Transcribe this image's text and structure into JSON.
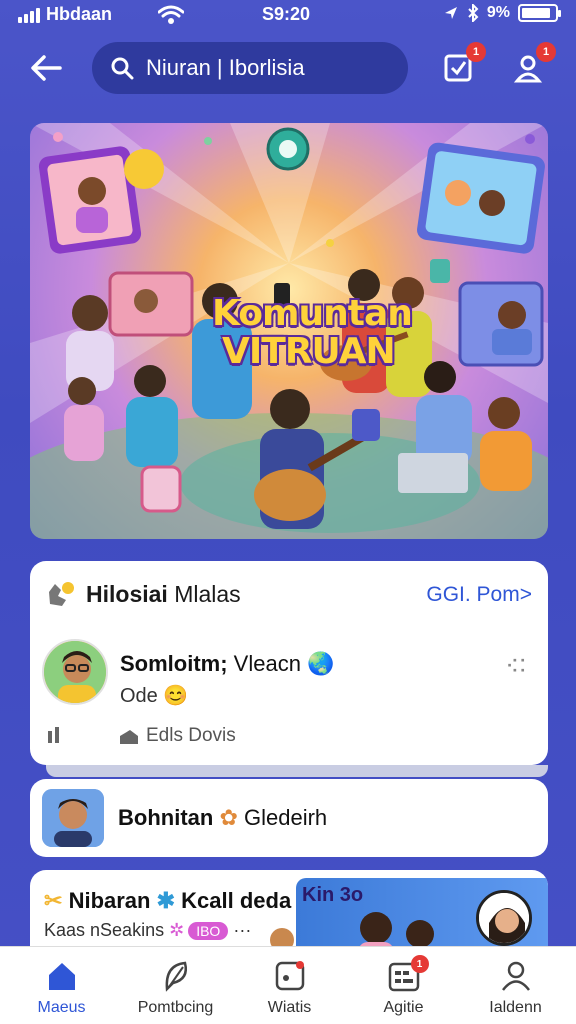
{
  "status_bar": {
    "carrier": "Hbdaan",
    "time": "S9:20",
    "battery_text": "9%"
  },
  "header": {
    "search_text": "Niuran | Iborlisia",
    "notifications_badge": "1",
    "profile_badge": "1"
  },
  "hero": {
    "title_line1": "Komuntan",
    "title_line2": "VITRUAN"
  },
  "card_1": {
    "title_bold": "Hilosiai",
    "title_rest": " Mlalas",
    "see_all": "GGI. Pom>",
    "post_name_bold": "Somloitm;",
    "post_name_rest": " Vleacn",
    "post_meta": "Ode",
    "action_label": "Edls Dovis"
  },
  "card_2": {
    "name_bold": "Bohnitan",
    "name_rest": "Gledeirh"
  },
  "card_3": {
    "title": "Nibaran",
    "title_rest": "Kcall deda",
    "subtitle": "Kaas nSeakins",
    "pill": "IBO",
    "thumb_text": "Kin 3o"
  },
  "bottom_nav": {
    "items": [
      {
        "label": "Maeus",
        "icon": "home-icon",
        "active": true
      },
      {
        "label": "Pomtbcing",
        "icon": "compass-icon",
        "active": false
      },
      {
        "label": "Wiatis",
        "icon": "post-icon",
        "active": false
      },
      {
        "label": "Agitie",
        "icon": "calendar-icon",
        "badge": "1",
        "active": false
      },
      {
        "label": "Ialdenn",
        "icon": "profile-icon",
        "active": false
      }
    ]
  },
  "colors": {
    "background": "#4650c6",
    "accent": "#2f56d6",
    "badge": "#e53935"
  }
}
